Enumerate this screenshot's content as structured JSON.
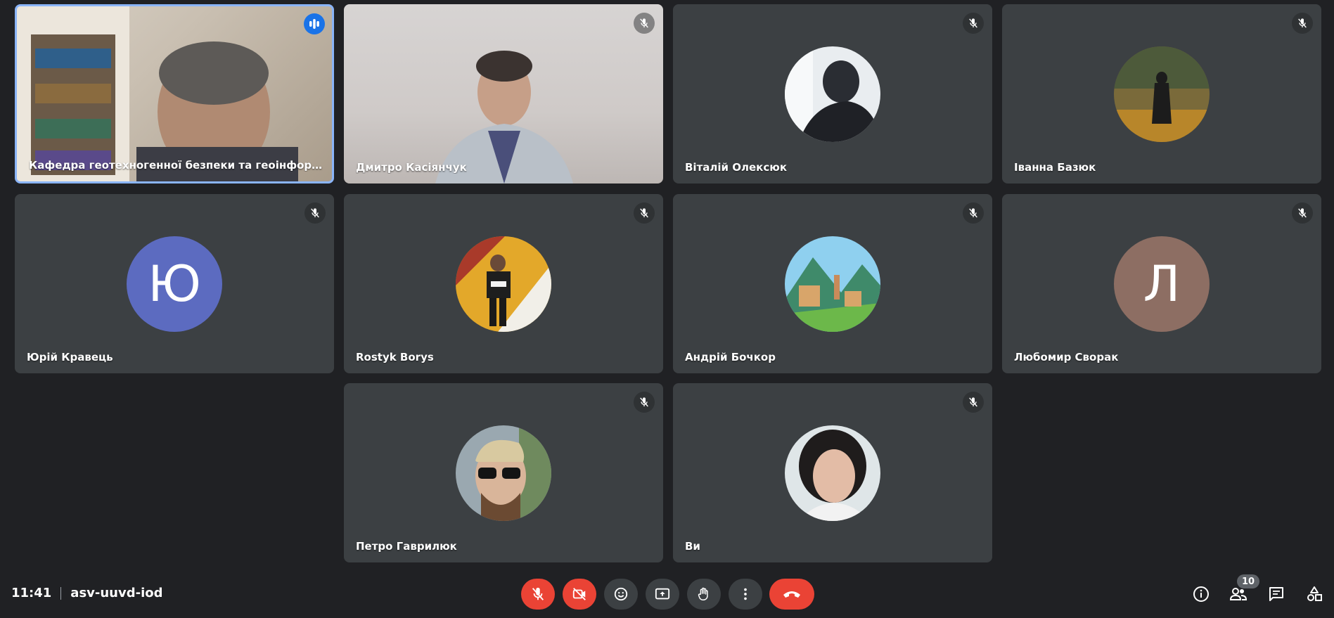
{
  "participants": [
    {
      "name": "Кафедра геотехногенної безпеки та геоінформатик…",
      "type": "video"
    },
    {
      "name": "Дмитро Касіянчук",
      "type": "video"
    },
    {
      "name": "Віталій Олексюк",
      "type": "photo"
    },
    {
      "name": "Іванна Базюк",
      "type": "photo"
    },
    {
      "name": "Юрій Кравець",
      "type": "letter",
      "initial": "Ю",
      "color": "#5c6bc0"
    },
    {
      "name": "Rostyk Borys",
      "type": "photo"
    },
    {
      "name": "Андрій Бочкор",
      "type": "photo"
    },
    {
      "name": "Любомир Сворак",
      "type": "letter",
      "initial": "Л",
      "color": "#8d6e63"
    },
    {
      "name": "Петро Гаврилюк",
      "type": "photo"
    },
    {
      "name": "Ви",
      "type": "photo"
    }
  ],
  "meeting": {
    "time": "11:41",
    "code": "asv-uuvd-iod"
  },
  "people_count": "10",
  "icons": {
    "mic_off": "mic-off-icon",
    "speaking": "audio-levels-icon",
    "controls": [
      "mic-off-icon",
      "camera-off-icon",
      "emoji-icon",
      "present-icon",
      "hand-icon",
      "more-vert-icon",
      "call-end-icon"
    ],
    "right": [
      "info-icon",
      "people-icon",
      "chat-icon",
      "activities-icon"
    ]
  },
  "colors": {
    "background": "#202124",
    "tile": "#3c4043",
    "active_border": "#8ab4f8",
    "danger": "#ea4335",
    "speaking": "#1a73e8"
  }
}
